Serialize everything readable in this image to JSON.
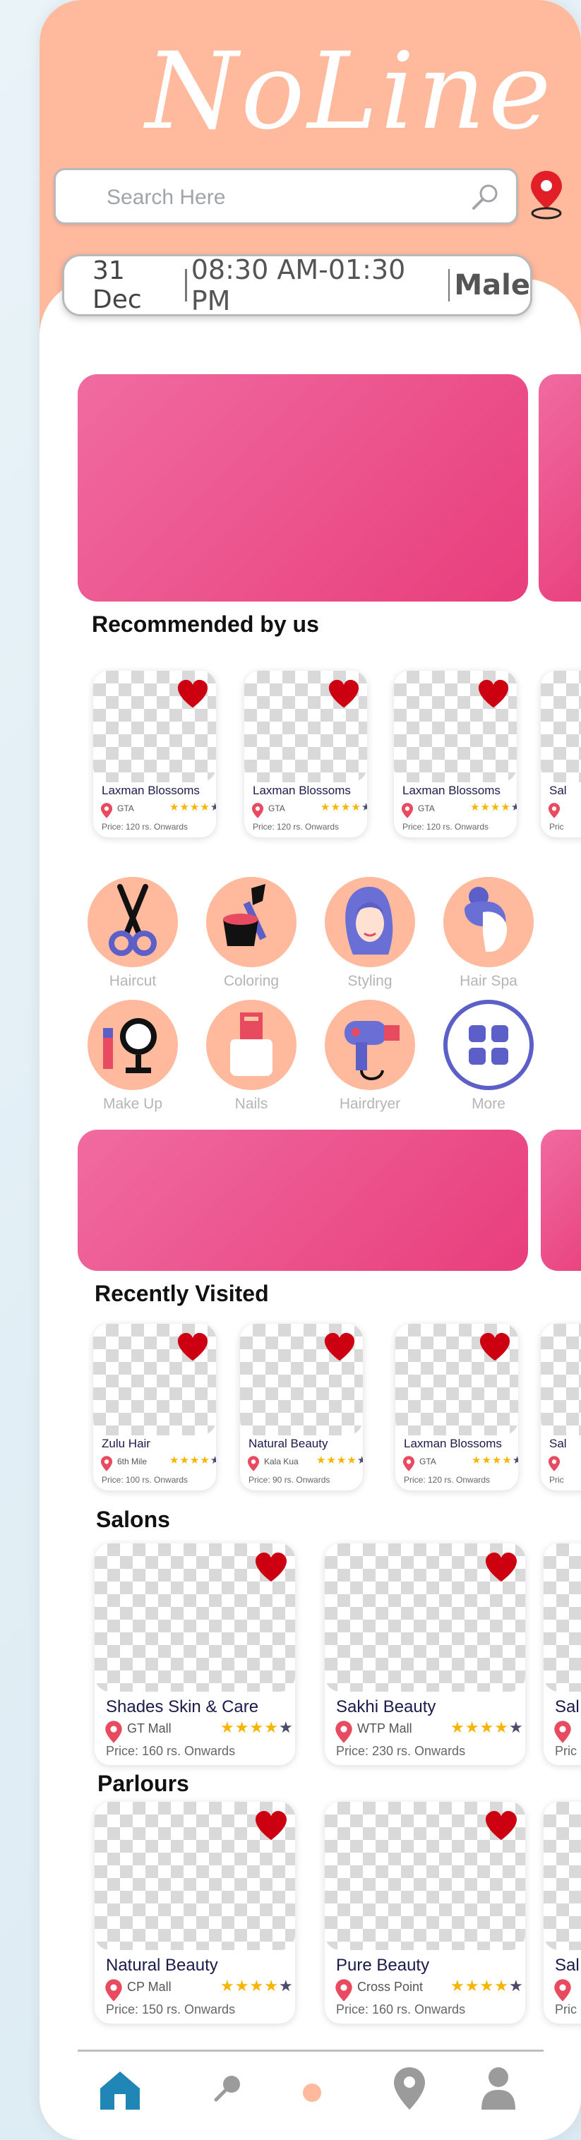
{
  "app": {
    "logo": "NoLine"
  },
  "search": {
    "placeholder": "Search Here"
  },
  "filter": {
    "date": "31 Dec",
    "time": "08:30 AM-01:30 PM",
    "gender": "Male"
  },
  "colors": {
    "header": "#ffb99d",
    "banner": "#e83e7c",
    "heart": "#cc0011",
    "pin": "#e84a5f",
    "star": "#f7b500",
    "nav_active": "#1f86b6",
    "nav_inactive": "#9b9b9b"
  },
  "recommended": {
    "title": "Recommended by us",
    "cards": [
      {
        "name": "Laxman Blossoms",
        "location": "GTA",
        "rating": 4,
        "price": "Price: 120 rs. Onwards"
      },
      {
        "name": "Laxman Blossoms",
        "location": "GTA",
        "rating": 4,
        "price": "Price: 120 rs. Onwards"
      },
      {
        "name": "Laxman Blossoms",
        "location": "GTA",
        "rating": 4,
        "price": "Price: 120 rs. Onwards"
      },
      {
        "name": "Sal",
        "location": "",
        "rating": 0,
        "price": "Pric"
      }
    ]
  },
  "categories": [
    {
      "label": "Haircut",
      "icon": "scissors-icon"
    },
    {
      "label": "Coloring",
      "icon": "hair-dye-icon"
    },
    {
      "label": "Styling",
      "icon": "woman-styling-icon"
    },
    {
      "label": "Hair Spa",
      "icon": "hair-spa-icon"
    },
    {
      "label": "Make Up",
      "icon": "makeup-mirror-icon"
    },
    {
      "label": "Nails",
      "icon": "nail-polish-icon"
    },
    {
      "label": "Hairdryer",
      "icon": "hairdryer-icon"
    },
    {
      "label": "More",
      "icon": "grid-more-icon"
    }
  ],
  "recent": {
    "title": "Recently Visited",
    "cards": [
      {
        "name": "Zulu Hair",
        "location": "6th Mile",
        "rating": 4,
        "price": "Price: 100 rs. Onwards"
      },
      {
        "name": "Natural Beauty",
        "location": "Kala Kua",
        "rating": 4,
        "price": "Price: 90 rs. Onwards"
      },
      {
        "name": "Laxman Blossoms",
        "location": "GTA",
        "rating": 4,
        "price": "Price: 120 rs. Onwards"
      },
      {
        "name": "Sal",
        "location": "",
        "rating": 0,
        "price": "Pric"
      }
    ]
  },
  "salons": {
    "title": "Salons",
    "cards": [
      {
        "name": "Shades Skin & Care",
        "location": "GT Mall",
        "rating": 4,
        "price": "Price: 160 rs. Onwards"
      },
      {
        "name": "Sakhi Beauty",
        "location": "WTP Mall",
        "rating": 4,
        "price": "Price: 230 rs. Onwards"
      },
      {
        "name": "Sal",
        "location": "",
        "rating": 0,
        "price": "Pric"
      }
    ]
  },
  "parlours": {
    "title": "Parlours",
    "cards": [
      {
        "name": "Natural Beauty",
        "location": "CP Mall",
        "rating": 4,
        "price": "Price: 150 rs. Onwards"
      },
      {
        "name": "Pure Beauty",
        "location": "Cross Point",
        "rating": 4,
        "price": "Price: 160 rs. Onwards"
      },
      {
        "name": "Sal",
        "location": "",
        "rating": 0,
        "price": "Pric"
      }
    ]
  },
  "nav": [
    {
      "name": "home",
      "icon": "home-icon",
      "active": true
    },
    {
      "name": "search",
      "icon": "search-icon",
      "active": false
    },
    {
      "name": "dot",
      "icon": "dot-icon",
      "active": false
    },
    {
      "name": "location",
      "icon": "location-icon",
      "active": false
    },
    {
      "name": "profile",
      "icon": "profile-icon",
      "active": false
    }
  ]
}
